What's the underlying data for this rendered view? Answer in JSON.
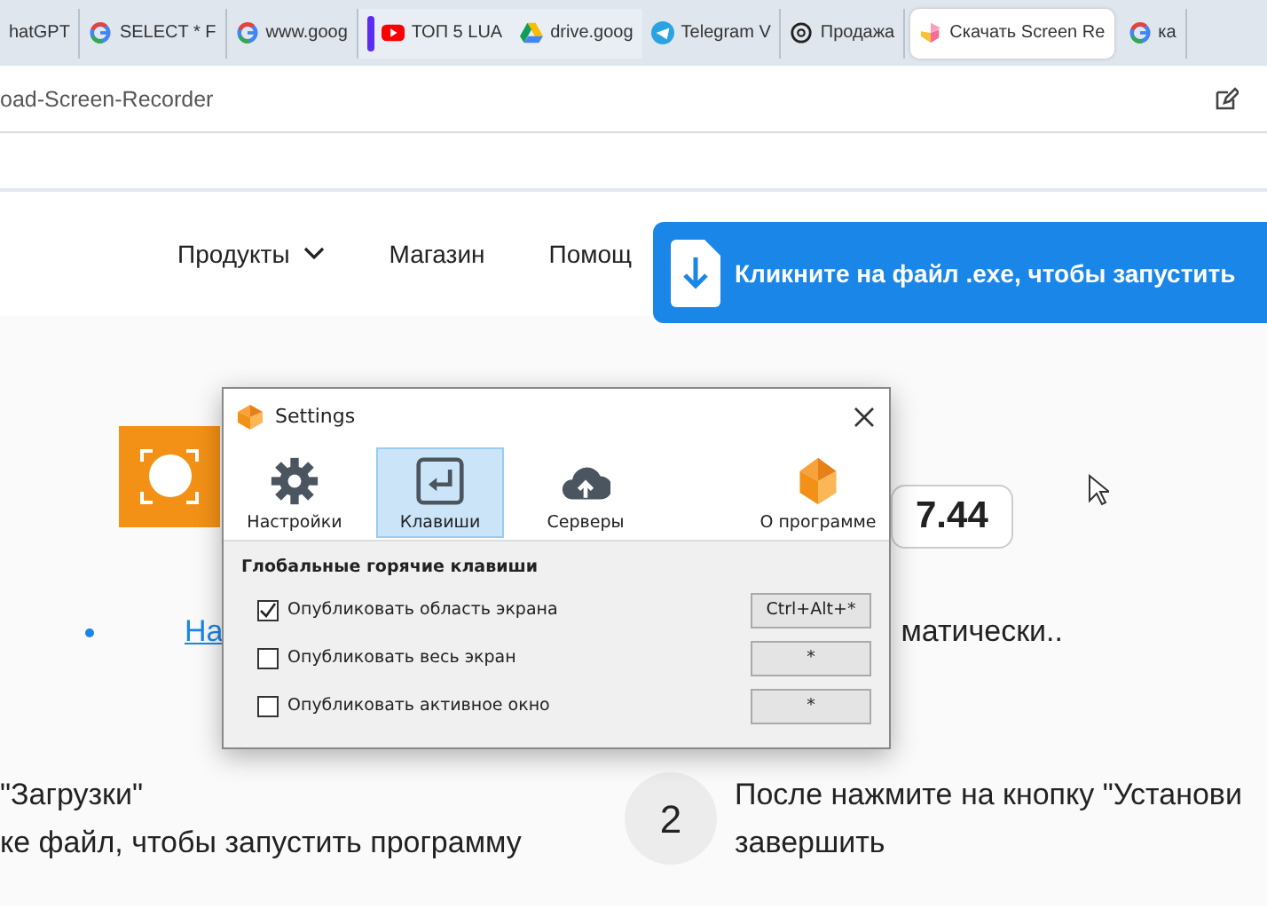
{
  "browser": {
    "tabs": [
      {
        "label": "hatGPT",
        "kind": "plain",
        "grouped": false,
        "selected": false
      },
      {
        "label": "SELECT * F",
        "kind": "google",
        "grouped": false,
        "selected": false
      },
      {
        "label": "www.goog",
        "kind": "google",
        "grouped": false,
        "selected": false
      },
      {
        "label": "ТОП 5 LUA",
        "kind": "youtube",
        "grouped": true,
        "selected": false
      },
      {
        "label": "drive.goog",
        "kind": "drive",
        "grouped": true,
        "selected": false
      },
      {
        "label": "Telegram V",
        "kind": "telegram",
        "grouped": false,
        "selected": false
      },
      {
        "label": "Продажа",
        "kind": "chatbot",
        "grouped": false,
        "selected": false
      },
      {
        "label": "Скачать Screen Re",
        "kind": "screen",
        "grouped": false,
        "selected": true
      },
      {
        "label": "ка",
        "kind": "google",
        "grouped": false,
        "selected": false
      }
    ],
    "address": "oad-Screen-Recorder"
  },
  "site": {
    "nav": [
      {
        "label": "Продукты",
        "dropdown": true
      },
      {
        "label": "Магазин",
        "dropdown": false
      },
      {
        "label": "Помощ",
        "dropdown": false
      }
    ],
    "banner": "Кликните на файл .exe, чтобы запустить",
    "version": "7.44",
    "bullet_link": "На",
    "bullet_text": "матически..",
    "steps": [
      {
        "lines": [
          "\"Загрузки\"",
          "ке файл, чтобы запустить программу"
        ]
      },
      {
        "number": "2",
        "lines": [
          "После нажмите на кнопку \"Установи",
          "завершить"
        ]
      }
    ]
  },
  "dialog": {
    "title": "Settings",
    "toolbar": [
      {
        "label": "Настройки",
        "kind": "gear",
        "selected": false
      },
      {
        "label": "Клавиши",
        "kind": "enter",
        "selected": true
      },
      {
        "label": "Серверы",
        "kind": "cloud",
        "selected": false
      },
      {
        "label": "О программе",
        "kind": "logo",
        "selected": false
      }
    ],
    "section": "Глобальные горячие клавиши",
    "hotkeys": [
      {
        "label": "Опубликовать область экрана",
        "checked": true,
        "key": "Ctrl+Alt+*"
      },
      {
        "label": "Опубликовать весь экран",
        "checked": false,
        "key": "*"
      },
      {
        "label": "Опубликовать активное окно",
        "checked": false,
        "key": "*"
      }
    ]
  }
}
